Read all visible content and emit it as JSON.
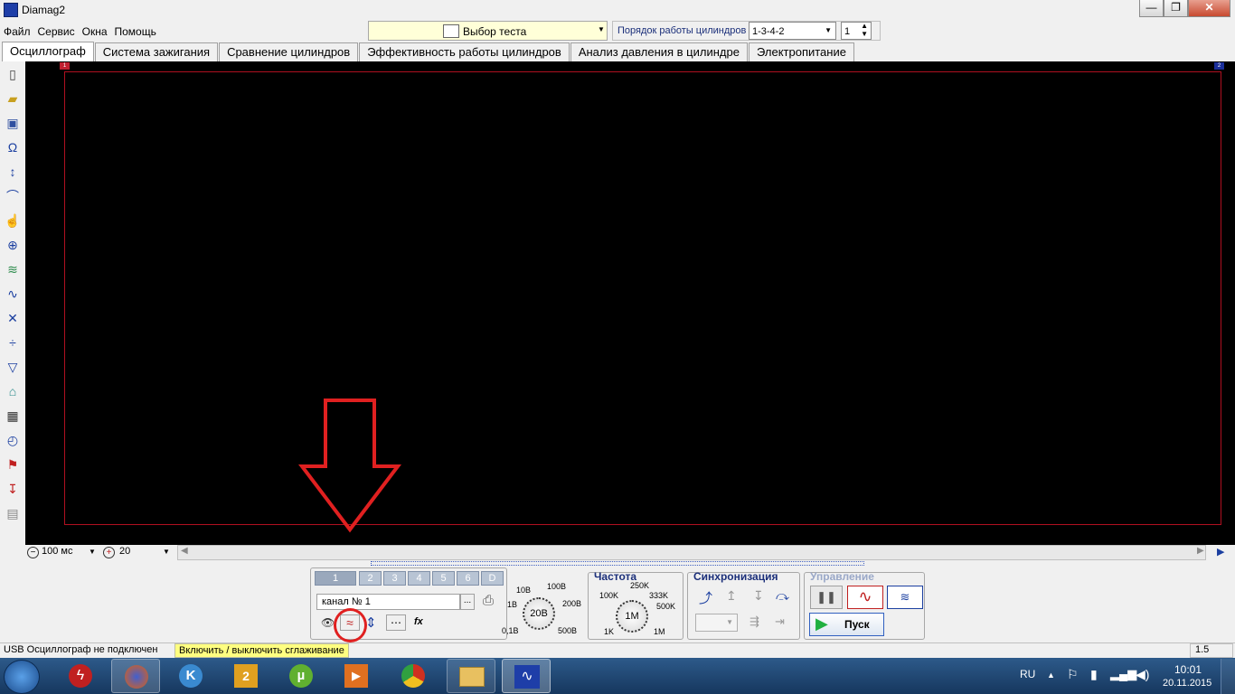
{
  "window": {
    "title": "Diamag2",
    "minimize": "—",
    "maximize": "❐",
    "close": "✕"
  },
  "menu": [
    "Файл",
    "Сервис",
    "Окна",
    "Помощь"
  ],
  "toolbar": {
    "test_select": "Выбор теста",
    "cylinder_order_label": "Порядок работы цилиндров",
    "cylinder_order_value": "1-3-4-2",
    "cylinder_number": "1"
  },
  "tabs": [
    "Осциллограф",
    "Система зажигания",
    "Сравнение цилиндров",
    "Эффективность работы цилиндров",
    "Анализ давления в цилиндре",
    "Электропитание"
  ],
  "scope": {
    "marker_left": "1",
    "marker_right": "2"
  },
  "timebase": {
    "value": "100 мс",
    "zoom": "20"
  },
  "channels": {
    "buttons": [
      "1",
      "2",
      "3",
      "4",
      "5",
      "6",
      "D"
    ],
    "channel_name": "канал № 1",
    "dots": "...",
    "fx": "fx"
  },
  "voltage_knob": {
    "labels": [
      "10В",
      "100В",
      "1В",
      "200В",
      "0,1В",
      "500В"
    ],
    "value": "20В"
  },
  "frequency": {
    "title": "Частота",
    "labels": [
      "250K",
      "100K",
      "333K",
      "500K",
      "1K",
      "1M"
    ],
    "value": "1M"
  },
  "sync": {
    "title": "Синхронизация"
  },
  "control": {
    "title": "Управление",
    "start": "Пуск"
  },
  "status": {
    "connection": "USB Осциллограф не подключен",
    "hint": "Включить / выключить сглаживание",
    "version": "1.5"
  },
  "taskbar": {
    "lang": "RU",
    "time": "10:01",
    "date": "20.11.2015"
  },
  "colors": {
    "accent": "#1b3fa0",
    "scope_bg": "#000000",
    "frame": "#b01020",
    "annotation": "#e02020",
    "hint_bg": "#ffff80"
  }
}
